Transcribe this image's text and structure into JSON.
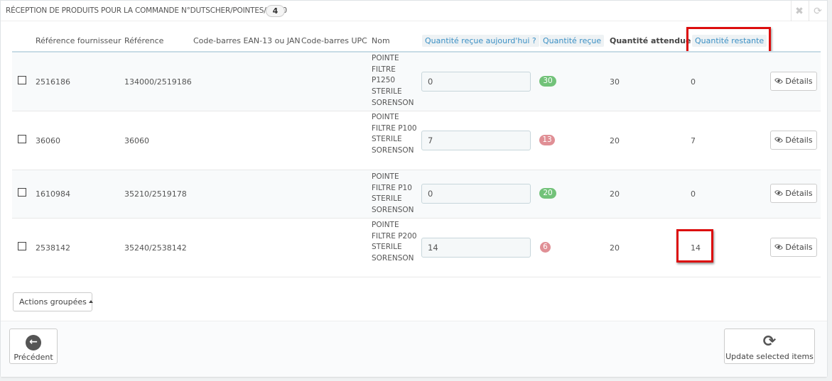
{
  "header": {
    "title": "Réception de produits pour la commande n°DUTSCHER/POINTES/26/10",
    "count": "4",
    "close_icon": "close-icon",
    "refresh_icon": "refresh-icon"
  },
  "table": {
    "columns": {
      "supplier_ref": "Référence fournisseur",
      "reference": "Référence",
      "ean13": "Code-barres EAN-13 ou JAN",
      "upc": "Code-barres UPC",
      "name": "Nom",
      "qty_today": "Quantité reçue aujourd'hui ?",
      "qty_received": "Quantité reçue",
      "qty_expected": "Quantité attendue",
      "qty_remaining": "Quantité restante"
    },
    "rows": [
      {
        "supplier_ref": "2516186",
        "reference": "134000/2519186",
        "ean13": "",
        "upc": "",
        "name": "POINTE FILTRE P1250 STERILE SORENSON",
        "qty_today": "0",
        "qty_received": "30",
        "received_status": "complete",
        "qty_expected": "30",
        "qty_remaining": "0",
        "details_label": "Détails"
      },
      {
        "supplier_ref": "36060",
        "reference": "36060",
        "ean13": "",
        "upc": "",
        "name": "POINTE FILTRE P100 STERILE SORENSON",
        "qty_today": "7",
        "qty_received": "13",
        "received_status": "partial",
        "qty_expected": "20",
        "qty_remaining": "7",
        "details_label": "Détails"
      },
      {
        "supplier_ref": "1610984",
        "reference": "35210/2519178",
        "ean13": "",
        "upc": "",
        "name": "POINTE FILTRE P10 STERILE SORENSON",
        "qty_today": "0",
        "qty_received": "20",
        "received_status": "complete",
        "qty_expected": "20",
        "qty_remaining": "0",
        "details_label": "Détails"
      },
      {
        "supplier_ref": "2538142",
        "reference": "35240/2538142",
        "ean13": "",
        "upc": "",
        "name": "POINTE FILTRE P200 STERILE SORENSON",
        "qty_today": "14",
        "qty_received": "6",
        "received_status": "partial",
        "qty_expected": "20",
        "qty_remaining": "14",
        "details_label": "Détails"
      }
    ]
  },
  "bulk_actions_label": "Actions groupées",
  "footer": {
    "back_label": "Précédent",
    "update_label": "Update selected items"
  },
  "colors": {
    "badge_complete": "#72c279",
    "badge_partial": "#e08f95",
    "highlight": "#dc0d0d",
    "link": "#3a8fc4"
  }
}
